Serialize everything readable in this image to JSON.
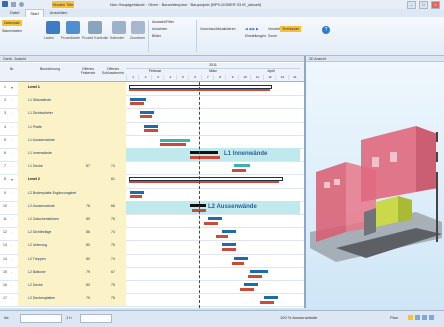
{
  "title_bar": {
    "app_tab": "Hidden Title",
    "title": "Neu Hauptgebäude · Oben · Bauzeitenplan · Bauprojekt (BPS-DOBER 03 IE_aktuell)"
  },
  "ribbon": {
    "tabs": [
      "Datei",
      "Start",
      "Ansichten"
    ],
    "active_tab": "Start",
    "groups": {
      "dataset": [
        "Datensatz",
        "Stammdaten"
      ],
      "buttons": [
        "Laden",
        "Prozeßkarte",
        "Prozeß Kontrolle",
        "Kalender",
        "Zuordnen"
      ],
      "view_rows": [
        "Auswahl/Filter",
        "Ansichten",
        "Bilder"
      ],
      "right_rows": [
        "Vorschau/Aktualisieren",
        "Einstellungen",
        "Zoom"
      ],
      "right_small": [
        "Vorwärts 0 h",
        "Terminplan"
      ]
    }
  },
  "left_pane": {
    "header": "Gantt - Ansicht"
  },
  "right_pane": {
    "header": "3D Ansicht"
  },
  "grid": {
    "col_headers": [
      "Nr.",
      "Bezeichnung",
      "Offenes Fristende",
      "Offenes Schlusstermin"
    ],
    "timeline_top": [
      "2011"
    ],
    "timeline_mid": [
      "Februar",
      "März",
      "April"
    ],
    "timeline_days": [
      "1",
      "2",
      "3",
      "4",
      "5",
      "6",
      "7",
      "8",
      "9",
      "10",
      "11",
      "12",
      "13",
      "14"
    ]
  },
  "rows": [
    {
      "num": "1",
      "name": "Level 1",
      "v1": "",
      "v2": "",
      "bold": true,
      "expander": "▾"
    },
    {
      "num": "2",
      "name": "L1 Stützwände",
      "v1": "",
      "v2": "",
      "bold": false,
      "expander": "·"
    },
    {
      "num": "3",
      "name": "L1 Dichtschleier",
      "v1": "",
      "v2": "",
      "bold": false,
      "expander": "·"
    },
    {
      "num": "4",
      "name": "L1 Platte",
      "v1": "",
      "v2": "",
      "bold": false,
      "expander": "·"
    },
    {
      "num": "5",
      "name": "L1 Aussenwände",
      "v1": "",
      "v2": "",
      "bold": false,
      "expander": "·"
    },
    {
      "num": "6",
      "name": "L1 Innenwände",
      "v1": "",
      "v2": "",
      "bold": false,
      "expander": "·"
    },
    {
      "num": "7",
      "name": "L1 Decke",
      "v1": "87",
      "v2": "74",
      "bold": false,
      "expander": "·"
    },
    {
      "num": "8",
      "name": "Level 2",
      "v1": "",
      "v2": "81",
      "bold": true,
      "expander": "▾"
    },
    {
      "num": "9",
      "name": "L2 Bodenplatte-Ergänzungsbeton",
      "v1": "",
      "v2": "",
      "bold": false,
      "expander": "·"
    },
    {
      "num": "10",
      "name": "L2 Aussenwände",
      "v1": "76",
      "v2": "66",
      "bold": false,
      "expander": "·"
    },
    {
      "num": "11",
      "name": "L2 Zwischenstützen",
      "v1": "89",
      "v2": "76",
      "bold": false,
      "expander": "·"
    },
    {
      "num": "12",
      "name": "L2 Dichtbeläge",
      "v1": "86",
      "v2": "74",
      "bold": false,
      "expander": "·"
    },
    {
      "num": "13",
      "name": "L2 Unterzug",
      "v1": "80",
      "v2": "75",
      "bold": false,
      "expander": "·"
    },
    {
      "num": "14",
      "name": "L2 Treppen",
      "v1": "80",
      "v2": "74",
      "bold": false,
      "expander": "·"
    },
    {
      "num": "15",
      "name": "L2 Balkone",
      "v1": "79",
      "v2": "67",
      "bold": false,
      "expander": "·"
    },
    {
      "num": "16",
      "name": "L2 Decke",
      "v1": "80",
      "v2": "75",
      "bold": false,
      "expander": "·"
    },
    {
      "num": "17",
      "name": "L2 Deckenplatten",
      "v1": "79",
      "v2": "75",
      "bold": false,
      "expander": "·"
    }
  ],
  "highlights": {
    "l1_innenwaende": "L1 Innenwände",
    "l2_aussenwaende": "L2 Aussenwände"
  },
  "status_bar": {
    "left": "Ist:",
    "zoom": "1 h",
    "right": "100 % Aussenwände",
    "far_right": "Plan"
  },
  "colors": {
    "plan_bar": "#1f6aa8",
    "actual_bar": "#c94b3a",
    "done_bar": "#3fb3a8",
    "critical_bar": "#111111",
    "highlight_row": "#bfe9ed",
    "today_line": "#3c3cb0"
  }
}
